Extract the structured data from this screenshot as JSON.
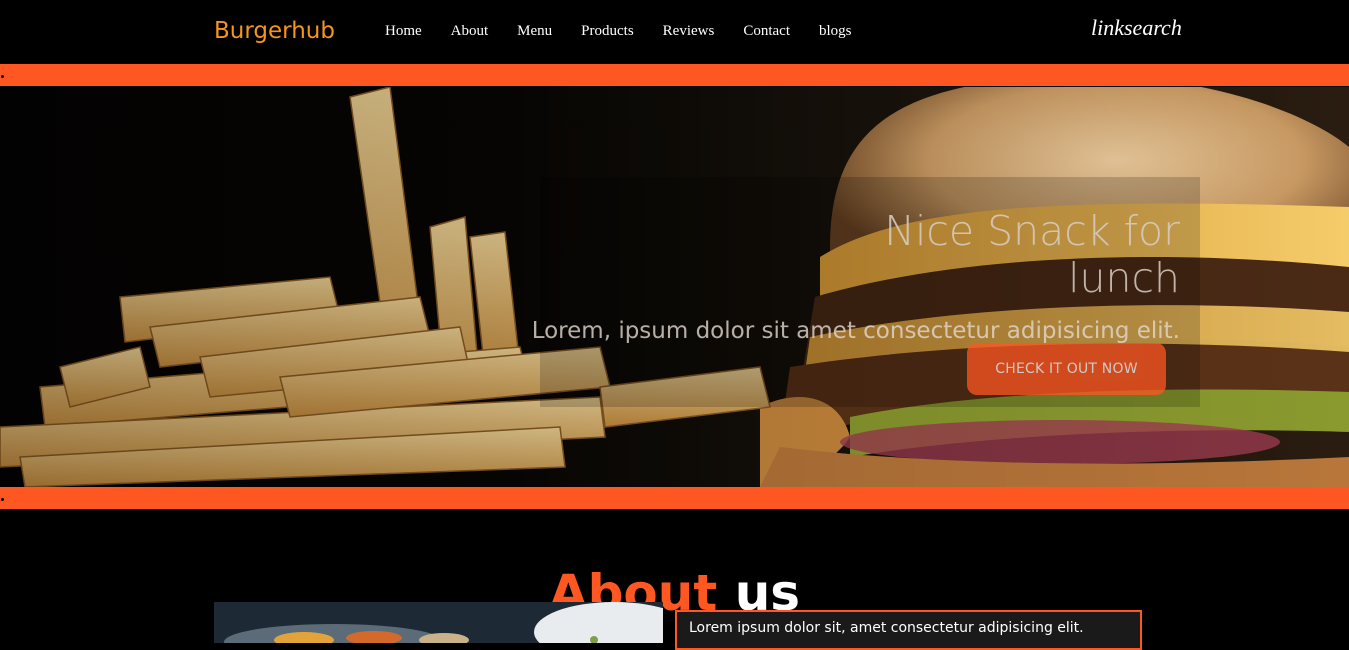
{
  "navbar": {
    "brand": "Burgerhub",
    "links": [
      "Home",
      "About",
      "Menu",
      "Products",
      "Reviews",
      "Contact",
      "blogs"
    ],
    "right_link": "linksearch"
  },
  "hero": {
    "title": "Nice Snack for lunch",
    "subtitle": "Lorem, ipsum dolor sit amet consectetur adipisicing elit.",
    "button": "CHECK IT OUT NOW"
  },
  "about": {
    "title_accent": "About",
    "title_rest": "us",
    "text": "Lorem ipsum dolor sit, amet consectetur adipisicing elit."
  },
  "colors": {
    "accent": "#ff5722",
    "brand": "#f7941d",
    "background": "#000000"
  }
}
